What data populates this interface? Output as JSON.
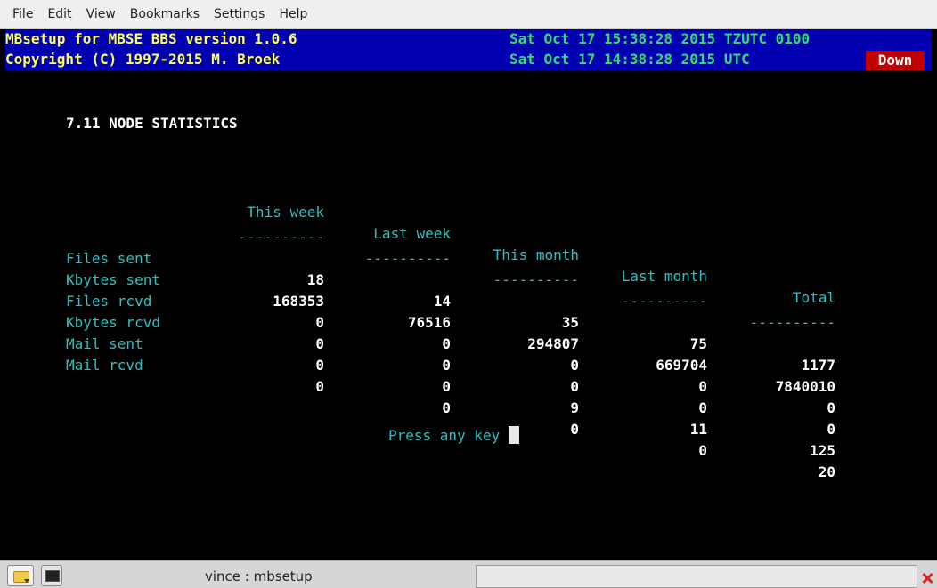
{
  "menubar": {
    "items": [
      "File",
      "Edit",
      "View",
      "Bookmarks",
      "Settings",
      "Help"
    ]
  },
  "terminal": {
    "app_line": "MBsetup for MBSE BBS version 1.0.6",
    "copyright_line": "Copyright (C) 1997-2015 M. Broek",
    "local_time": "Sat Oct 17 15:38:28 2015 TZUTC 0100",
    "utc_time": "Sat Oct 17 14:38:28 2015 UTC",
    "status_badge": "Down",
    "heading": "7.11 NODE STATISTICS",
    "columns": [
      "This week",
      "Last week",
      "This month",
      "Last month",
      "Total"
    ],
    "separator": "----------",
    "rows": [
      {
        "label": "Files sent",
        "values": [
          "18",
          "14",
          "35",
          "75",
          "1177"
        ]
      },
      {
        "label": "Kbytes sent",
        "values": [
          "168353",
          "76516",
          "294807",
          "669704",
          "7840010"
        ]
      },
      {
        "label": "Files rcvd",
        "values": [
          "0",
          "0",
          "0",
          "0",
          "0"
        ]
      },
      {
        "label": "Kbytes rcvd",
        "values": [
          "0",
          "0",
          "0",
          "0",
          "0"
        ]
      },
      {
        "label": "Mail sent",
        "values": [
          "0",
          "0",
          "9",
          "11",
          "125"
        ]
      },
      {
        "label": "Mail rcvd",
        "values": [
          "0",
          "0",
          "0",
          "0",
          "20"
        ]
      }
    ],
    "prompt": "Press any key"
  },
  "taskbar": {
    "task_label": "vince : mbsetup",
    "icons": [
      "folder-icon",
      "terminal-icon",
      "close-tray-icon"
    ]
  },
  "colors": {
    "title_bar_bg": "#0000b0",
    "title_text": "#ffff55",
    "time_text": "#2ee06a",
    "label_text": "#2ec0c0",
    "value_text": "#ffffff",
    "down_badge_bg": "#c00000"
  }
}
